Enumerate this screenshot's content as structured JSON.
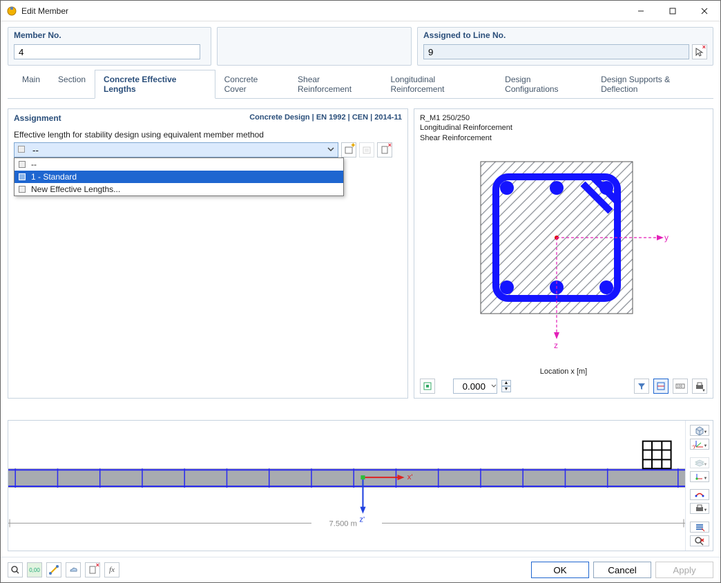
{
  "window": {
    "title": "Edit Member"
  },
  "top": {
    "member_no_label": "Member No.",
    "member_no_value": "4",
    "assigned_label": "Assigned to Line No.",
    "assigned_value": "9"
  },
  "tabs": [
    "Main",
    "Section",
    "Concrete Effective Lengths",
    "Concrete Cover",
    "Shear Reinforcement",
    "Longitudinal Reinforcement",
    "Design Configurations",
    "Design Supports & Deflection"
  ],
  "active_tab": 2,
  "assignment": {
    "title": "Assignment",
    "design_code": "Concrete Design | EN 1992 | CEN | 2014-11",
    "field_label": "Effective length for stability design using equivalent member method",
    "current": "--",
    "options": [
      "--",
      "1 - Standard",
      "New Effective Lengths..."
    ],
    "highlighted": 1
  },
  "preview": {
    "lines": [
      "R_M1 250/250",
      "Longitudinal Reinforcement",
      "Shear Reinforcement"
    ],
    "axis_y": "y",
    "axis_z": "z",
    "location_label": "Location x [m]",
    "location_value": "0.000"
  },
  "elevation": {
    "length_label": "7.500 m",
    "axis_x": "x'",
    "axis_z": "z'"
  },
  "buttons": {
    "ok": "OK",
    "cancel": "Cancel",
    "apply": "Apply"
  }
}
